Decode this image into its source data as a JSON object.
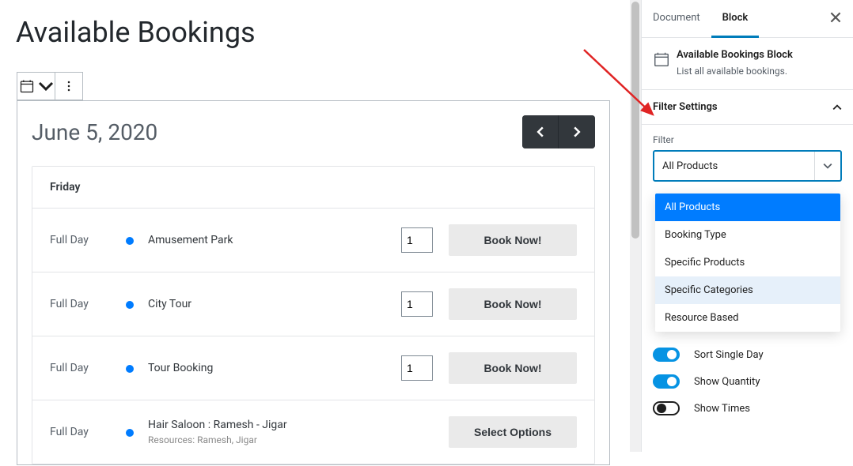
{
  "page": {
    "title": "Available Bookings"
  },
  "block": {
    "date_label": "June 5, 2020",
    "day_name": "Friday",
    "rows": [
      {
        "time": "Full Day",
        "title": "Amusement Park",
        "sub": "",
        "qty": "1",
        "action": "Book Now!",
        "has_qty": true
      },
      {
        "time": "Full Day",
        "title": "City Tour",
        "sub": "",
        "qty": "1",
        "action": "Book Now!",
        "has_qty": true
      },
      {
        "time": "Full Day",
        "title": "Tour Booking",
        "sub": "",
        "qty": "1",
        "action": "Book Now!",
        "has_qty": true
      },
      {
        "time": "Full Day",
        "title": "Hair Saloon : Ramesh - Jigar",
        "sub": "Resources: Ramesh, Jigar",
        "qty": "",
        "action": "Select Options",
        "has_qty": false
      }
    ]
  },
  "sidebar": {
    "tabs": {
      "document": "Document",
      "block": "Block"
    },
    "card": {
      "title": "Available Bookings Block",
      "desc": "List all available bookings."
    },
    "panel_title": "Filter Settings",
    "filter_label": "Filter",
    "filter_value": "All Products",
    "dropdown": [
      {
        "label": "All Products",
        "state": "selected"
      },
      {
        "label": "Booking Type",
        "state": ""
      },
      {
        "label": "Specific Products",
        "state": ""
      },
      {
        "label": "Specific Categories",
        "state": "hover"
      },
      {
        "label": "Resource Based",
        "state": ""
      }
    ],
    "toggles": [
      {
        "label": "Sort Single Day",
        "on": true
      },
      {
        "label": "Show Quantity",
        "on": true
      },
      {
        "label": "Show Times",
        "on": false
      }
    ]
  }
}
